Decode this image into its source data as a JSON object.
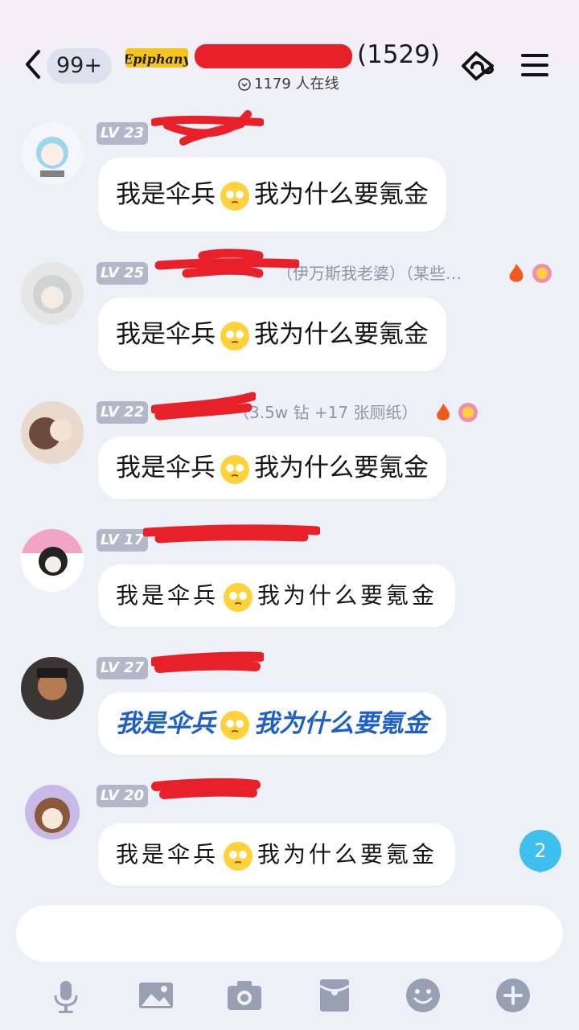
{
  "header": {
    "unread_badge": "99+",
    "logo_text": "Epiphany",
    "title_suffix": "(1529)",
    "online_text": "1179 人在线",
    "back_icon": "chevron-left-icon",
    "share_icon": "share-link-icon",
    "menu_icon": "hamburger-menu-icon"
  },
  "messages": [
    {
      "level": "LV 23",
      "name_suffix": "",
      "text_a": "我是伞兵",
      "text_b": "我为什么要氪金",
      "style": "normal"
    },
    {
      "level": "LV 25",
      "name_suffix": "（伊万斯我老婆）（某些…",
      "text_a": "我是伞兵",
      "text_b": "我为什么要氪金",
      "style": "normal"
    },
    {
      "level": "LV 22",
      "name_suffix": "（3.5w 钻 +17 张厕纸）",
      "text_a": "我是伞兵",
      "text_b": "我为什么要氪金",
      "style": "normal"
    },
    {
      "level": "LV 17",
      "name_suffix": "",
      "text_a": "我是伞兵",
      "text_b": "我为什么要氪金",
      "style": "cursive"
    },
    {
      "level": "LV 27",
      "name_suffix": "",
      "text_a": "我是伞兵",
      "text_b": "我为什么要氪金",
      "style": "blue"
    },
    {
      "level": "LV 20",
      "name_suffix": "",
      "text_a": "我是伞兵",
      "text_b": "我为什么要氪金",
      "style": "cursive"
    }
  ],
  "unread_count": "2",
  "toolbar": {
    "icons": [
      "microphone-icon",
      "image-icon",
      "camera-icon",
      "red-packet-icon",
      "emoji-icon",
      "plus-icon"
    ]
  },
  "colors": {
    "background": "#eef0f7",
    "level_badge": "#b3b7ca",
    "redaction": "#e8202a",
    "unread": "#3ebfee",
    "blue_text": "#1f5fc8"
  }
}
